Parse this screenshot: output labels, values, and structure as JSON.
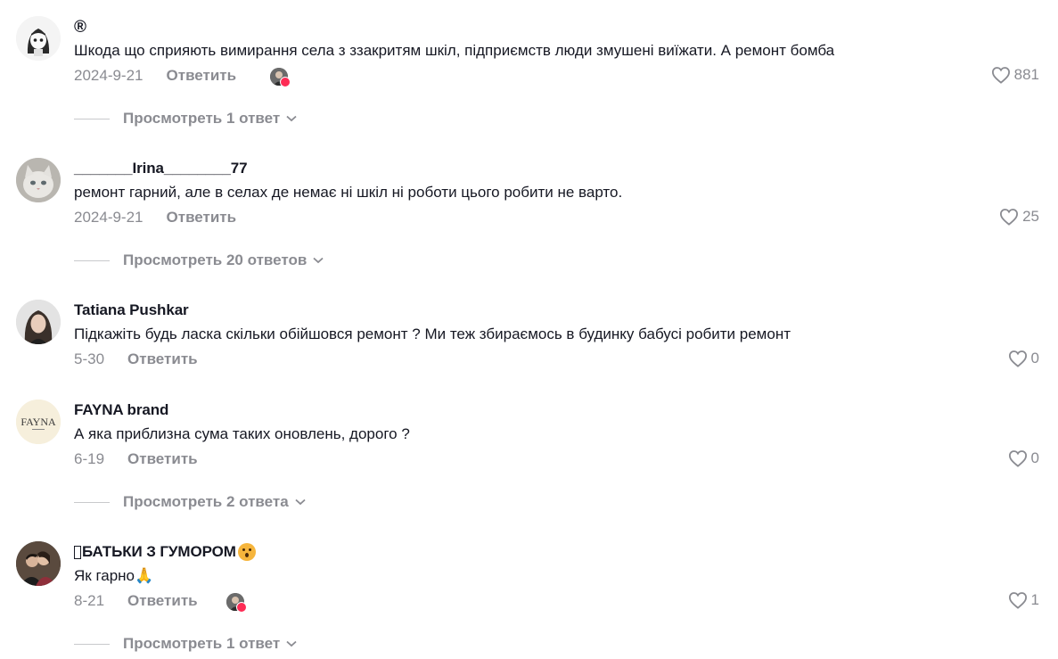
{
  "comments": [
    {
      "username": "®",
      "text": "Шкода що сприяють вимирання села з ззакритям шкіл, підприємств люди змушені виїжати. А ремонт бомба",
      "date": "2024-9-21",
      "reply_label": "Ответить",
      "likes": "881",
      "creator_liked": true,
      "view_replies": "Просмотреть 1 ответ",
      "avatar_icon": "anime-girl-avatar"
    },
    {
      "username": "_______Irina________77",
      "text": "ремонт гарний, але в селах де немає ні шкіл ні роботи цього робити не варто.",
      "date": "2024-9-21",
      "reply_label": "Ответить",
      "likes": "25",
      "creator_liked": false,
      "view_replies": "Просмотреть 20 ответов",
      "avatar_icon": "cat-avatar"
    },
    {
      "username": "Tatiana Pushkar",
      "text": "Підкажіть будь ласка скільки обійшовся ремонт ? Ми теж збираємось в будинку бабусі робити ремонт",
      "date": "5-30",
      "reply_label": "Ответить",
      "likes": "0",
      "creator_liked": false,
      "view_replies": "",
      "avatar_icon": "woman-portrait-avatar"
    },
    {
      "username": "FAYNA brand",
      "text": "А яка приблизна сума таких оновлень, дорого ?",
      "date": "6-19",
      "reply_label": "Ответить",
      "likes": "0",
      "creator_liked": false,
      "view_replies": "Просмотреть 2 ответа",
      "avatar_icon": "fayna-logo-avatar",
      "avatar_text": "FAYNA"
    },
    {
      "username": "БАТЬКИ З ГУМОРОМ",
      "text": "Як гарно🙏",
      "date": "8-21",
      "reply_label": "Ответить",
      "likes": "1",
      "creator_liked": true,
      "view_replies": "Просмотреть 1 ответ",
      "avatar_icon": "couple-avatar"
    }
  ],
  "colors": {
    "muted": "#8a8b91",
    "text": "#161823",
    "heart_badge": "#fe2c55"
  }
}
